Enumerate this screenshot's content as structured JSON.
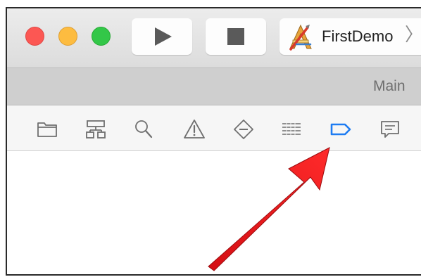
{
  "window": {
    "traffic_lights": {
      "close_color": "#fc5753",
      "minimize_color": "#fdbc40",
      "zoom_color": "#33c748"
    }
  },
  "toolbar": {
    "run_icon": "play-icon",
    "stop_icon": "stop-icon",
    "scheme": {
      "name": "FirstDemo",
      "icon": "xcode-app-icon",
      "chevron": "〉"
    }
  },
  "tabbar": {
    "title": "Main"
  },
  "navigator": {
    "selected_color": "#1e7cf2",
    "icons": [
      {
        "name": "folder-icon",
        "selected": false
      },
      {
        "name": "hierarchy-icon",
        "selected": false
      },
      {
        "name": "magnifier-icon",
        "selected": false
      },
      {
        "name": "warning-icon",
        "selected": false
      },
      {
        "name": "diamond-minus-icon",
        "selected": false
      },
      {
        "name": "list-icon",
        "selected": false
      },
      {
        "name": "breakpoint-icon",
        "selected": true
      },
      {
        "name": "speech-bubble-icon",
        "selected": false
      }
    ]
  },
  "annotation": {
    "arrow_color": "#e8161b"
  }
}
